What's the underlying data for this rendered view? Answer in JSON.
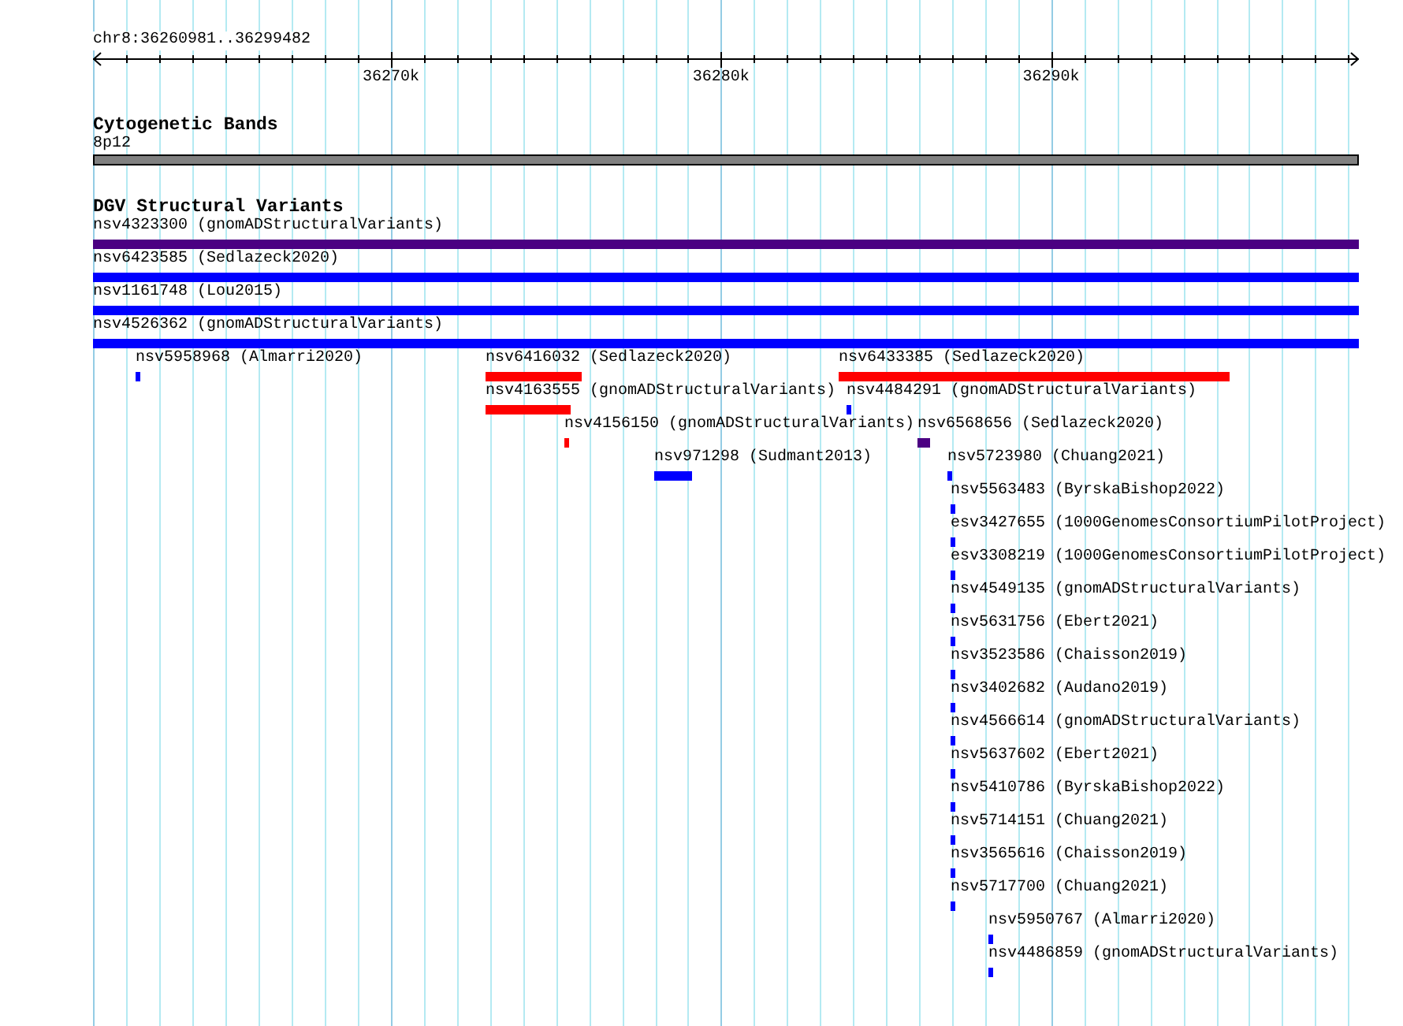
{
  "ruler": {
    "location": "chr8:36260981..36299482",
    "tick_labels": [
      "36270k",
      "36280k",
      "36290k"
    ]
  },
  "cytogenetic_track": {
    "title": "Cytogenetic Bands",
    "band_label": "8p12"
  },
  "dgv_track": {
    "title": "DGV Structural Variants",
    "features": [
      {
        "label": "nsv4323300 (gnomADStructuralVariants)",
        "color": "#4b0082"
      },
      {
        "label": "nsv6423585 (Sedlazeck2020)",
        "color": "#0000ff"
      },
      {
        "label": "nsv1161748 (Lou2015)",
        "color": "#0000ff"
      },
      {
        "label": "nsv4526362 (gnomADStructuralVariants)",
        "color": "#0000ff"
      },
      {
        "label": "nsv5958968 (Almarri2020)",
        "color": "#0000ff"
      },
      {
        "label": "nsv6416032 (Sedlazeck2020)",
        "color": "#ff0000"
      },
      {
        "label": "nsv6433385 (Sedlazeck2020)",
        "color": "#ff0000"
      },
      {
        "label": "nsv4163555 (gnomADStructuralVariants)",
        "color": "#ff0000"
      },
      {
        "label": "nsv4484291 (gnomADStructuralVariants)",
        "color": "#0000ff"
      },
      {
        "label": "nsv4156150 (gnomADStructuralVariants)",
        "color": "#ff0000"
      },
      {
        "label": "nsv6568656 (Sedlazeck2020)",
        "color": "#4b0082"
      },
      {
        "label": "nsv971298 (Sudmant2013)",
        "color": "#0000ff"
      },
      {
        "label": "nsv5723980 (Chuang2021)",
        "color": "#0000ff"
      },
      {
        "label": "nsv5563483 (ByrskaBishop2022)",
        "color": "#0000ff"
      },
      {
        "label": "esv3427655 (1000GenomesConsortiumPilotProject)",
        "color": "#0000ff"
      },
      {
        "label": "esv3308219 (1000GenomesConsortiumPilotProject)",
        "color": "#0000ff"
      },
      {
        "label": "nsv4549135 (gnomADStructuralVariants)",
        "color": "#0000ff"
      },
      {
        "label": "nsv5631756 (Ebert2021)",
        "color": "#0000ff"
      },
      {
        "label": "nsv3523586 (Chaisson2019)",
        "color": "#0000ff"
      },
      {
        "label": "nsv3402682 (Audano2019)",
        "color": "#0000ff"
      },
      {
        "label": "nsv4566614 (gnomADStructuralVariants)",
        "color": "#0000ff"
      },
      {
        "label": "nsv5637602 (Ebert2021)",
        "color": "#0000ff"
      },
      {
        "label": "nsv5410786 (ByrskaBishop2022)",
        "color": "#0000ff"
      },
      {
        "label": "nsv5714151 (Chuang2021)",
        "color": "#0000ff"
      },
      {
        "label": "nsv3565616 (Chaisson2019)",
        "color": "#0000ff"
      },
      {
        "label": "nsv5717700 (Chuang2021)",
        "color": "#0000ff"
      },
      {
        "label": "nsv5950767 (Almarri2020)",
        "color": "#0000ff"
      },
      {
        "label": "nsv4486859 (gnomADStructuralVariants)",
        "color": "#0000ff"
      }
    ]
  }
}
